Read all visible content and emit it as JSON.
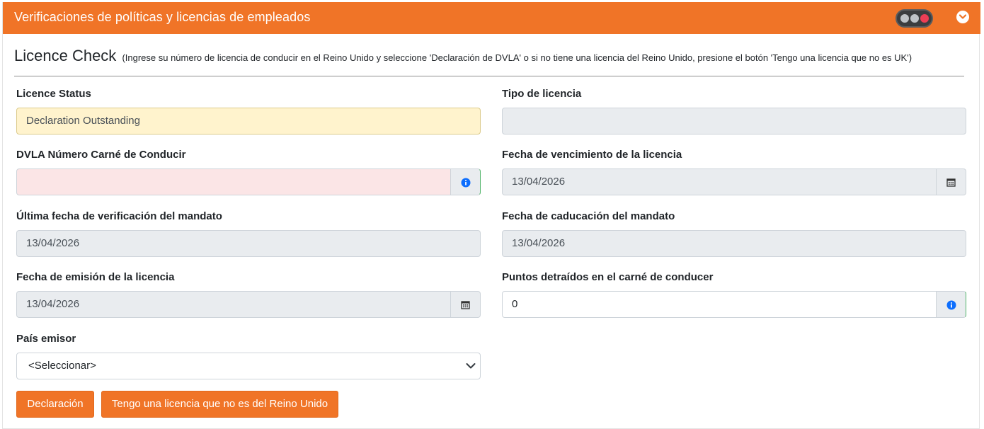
{
  "header": {
    "title": "Verificaciones de políticas y licencias de empleados",
    "status_indicator": "traffic-light-red",
    "collapse_icon": "chevron-down-icon"
  },
  "section": {
    "title": "Licence Check",
    "hint": "(Ingrese su número de licencia de conducir en el Reino Unido y seleccione 'Declaración de DVLA' o si no tiene una licencia del Reino Unido, presione el botón 'Tengo una licencia que no es UK')"
  },
  "fields": {
    "licence_status": {
      "label": "Licence Status",
      "value": "Declaration Outstanding"
    },
    "licence_type": {
      "label": "Tipo de licencia",
      "value": ""
    },
    "dvla_number": {
      "label": "DVLA Número Carné de Conducir",
      "value": "",
      "addon_icon": "info-icon"
    },
    "licence_expiry": {
      "label": "Fecha de vencimiento de la licencia",
      "value": "13/04/2026",
      "addon_icon": "calendar-icon"
    },
    "last_mandate_check": {
      "label": "Última fecha de verificación del mandato",
      "value": "13/04/2026"
    },
    "mandate_expiry": {
      "label": "Fecha de caducación del mandato",
      "value": "13/04/2026"
    },
    "licence_issue": {
      "label": "Fecha de emisión de la licencia",
      "value": "13/04/2026",
      "addon_icon": "calendar-icon"
    },
    "penalty_points": {
      "label": "Puntos detraídos en el carné de conducer",
      "value": "0",
      "addon_icon": "info-icon"
    },
    "issuing_country": {
      "label": "País emisor",
      "selected": "<Seleccionar>"
    }
  },
  "buttons": {
    "declaration": "Declaración",
    "non_uk_licence": "Tengo una licencia que no es del Reino Unido"
  },
  "colors": {
    "brand": "#f07427",
    "warning_bg": "#fff3cd",
    "error_bg": "#fbe5e6",
    "info_blue": "#0d6efd"
  }
}
